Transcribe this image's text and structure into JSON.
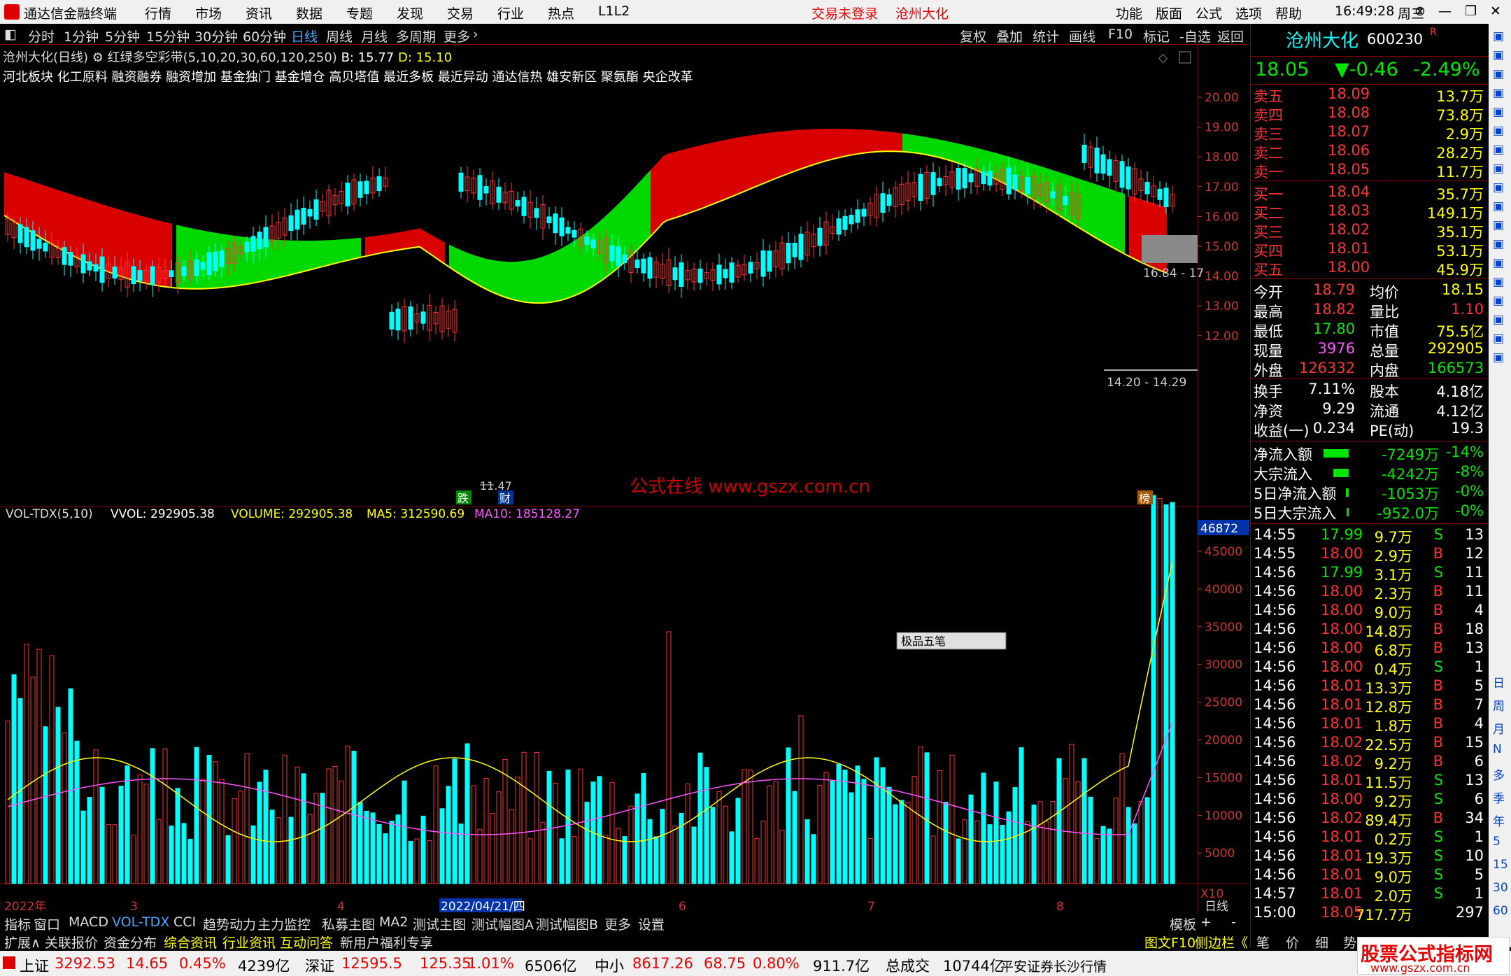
{
  "titlebar": {
    "app": "通达信金融终端",
    "menu": [
      "行情",
      "市场",
      "资讯",
      "数据",
      "专题",
      "发现",
      "交易",
      "行业",
      "热点",
      "L1L2"
    ],
    "login": "交易未登录",
    "stock": "沧州大化",
    "menu_right": [
      "功能",
      "版面",
      "公式",
      "选项",
      "帮助"
    ],
    "time": "16:49:28",
    "weekday": "周三"
  },
  "periodbar": {
    "items": [
      "分时",
      "1分钟",
      "5分钟",
      "15分钟",
      "30分钟",
      "60分钟",
      "日线",
      "周线",
      "月线",
      "多周期",
      "更多"
    ],
    "active": "日线",
    "right": [
      "复权",
      "叠加",
      "统计",
      "画线",
      "F10",
      "标记",
      "-自选",
      "返回"
    ]
  },
  "chart": {
    "name": "沧州大化(日线)",
    "indicator": "红绿多空彩带(5,10,20,30,60,120,250)",
    "b": "B: 15.77",
    "d": "D: 15.10",
    "concepts": "河北板块 化工原料 融资融券 融资增加 基金独门 基金增仓 高贝塔值 最近多板 最近异动 通达信热 雄安新区 聚氨酯 央企改革",
    "price_axis": [
      "20.00",
      "19.00",
      "18.00",
      "17.00",
      "16.00",
      "15.00",
      "14.00",
      "13.00",
      "12.00"
    ],
    "low_label": "11.47",
    "gap_label_1": "16.84 - 17",
    "gap_label_2": "14.20 - 14.29",
    "markers": [
      "跌",
      "财",
      "榜"
    ],
    "watermark": "公式在线  www.gszx.com.cn",
    "vol_info": {
      "name": "VOL-TDX(5,10)",
      "vvol": "VVOL: 292905.38",
      "volume": "VOLUME: 292905.38",
      "ma5": "MA5: 312590.69",
      "ma10": "MA10: 185128.27"
    },
    "vol_axis": [
      "45000",
      "40000",
      "35000",
      "30000",
      "25000",
      "20000",
      "15000",
      "10000",
      "5000"
    ],
    "vol_top": "46872",
    "vol_unit": "X10",
    "dates": [
      "2022年",
      "3",
      "4",
      "2022/04/21/四",
      "6",
      "7",
      "8"
    ],
    "period_label": "日线",
    "penbox": "极品五笔"
  },
  "quote": {
    "name": "沧州大化",
    "code": "600230",
    "price": "18.05",
    "change": "▼-0.46",
    "pct": "-2.49%",
    "sell": [
      [
        "卖五",
        "18.09",
        "13.7万"
      ],
      [
        "卖四",
        "18.08",
        "73.8万"
      ],
      [
        "卖三",
        "18.07",
        "2.9万"
      ],
      [
        "卖二",
        "18.06",
        "28.2万"
      ],
      [
        "卖一",
        "18.05",
        "11.7万"
      ]
    ],
    "buy": [
      [
        "买一",
        "18.04",
        "35.7万"
      ],
      [
        "买二",
        "18.03",
        "149.1万"
      ],
      [
        "买三",
        "18.02",
        "35.1万"
      ],
      [
        "买四",
        "18.01",
        "53.1万"
      ],
      [
        "买五",
        "18.00",
        "45.9万"
      ]
    ],
    "stats": [
      [
        "今开",
        "18.79",
        "均价",
        "18.15"
      ],
      [
        "最高",
        "18.82",
        "量比",
        "1.10"
      ],
      [
        "最低",
        "17.80",
        "市值",
        "75.5亿"
      ],
      [
        "现量",
        "3976",
        "总量",
        "292905"
      ],
      [
        "外盘",
        "126332",
        "内盘",
        "166573"
      ]
    ],
    "stats2": [
      [
        "换手",
        "7.11%",
        "股本",
        "4.18亿"
      ],
      [
        "净资",
        "9.29",
        "流通",
        "4.12亿"
      ],
      [
        "收益(一)",
        "0.234",
        "PE(动)",
        "19.3"
      ]
    ],
    "flows": [
      [
        "净流入额",
        "-7249万",
        "-14%"
      ],
      [
        "大宗流入",
        "-4242万",
        "-8%"
      ],
      [
        "5日净流入额",
        "-1053万",
        "-0%"
      ],
      [
        "5日大宗流入",
        "-952.0万",
        "-0%"
      ]
    ],
    "ticks": [
      [
        "14:55",
        "17.99",
        "9.7万",
        "S",
        "13"
      ],
      [
        "14:55",
        "18.00",
        "2.9万",
        "B",
        "12"
      ],
      [
        "14:56",
        "17.99",
        "3.1万",
        "S",
        "11"
      ],
      [
        "14:56",
        "18.00",
        "2.3万",
        "B",
        "11"
      ],
      [
        "14:56",
        "18.00",
        "9.0万",
        "B",
        "4"
      ],
      [
        "14:56",
        "18.00",
        "14.8万",
        "B",
        "18"
      ],
      [
        "14:56",
        "18.00",
        "6.8万",
        "B",
        "13"
      ],
      [
        "14:56",
        "18.00",
        "0.4万",
        "S",
        "1"
      ],
      [
        "14:56",
        "18.01",
        "13.3万",
        "B",
        "5"
      ],
      [
        "14:56",
        "18.01",
        "12.8万",
        "B",
        "7"
      ],
      [
        "14:56",
        "18.01",
        "1.8万",
        "B",
        "4"
      ],
      [
        "14:56",
        "18.02",
        "22.5万",
        "B",
        "15"
      ],
      [
        "14:56",
        "18.02",
        "9.2万",
        "B",
        "6"
      ],
      [
        "14:56",
        "18.01",
        "11.5万",
        "S",
        "13"
      ],
      [
        "14:56",
        "18.00",
        "9.2万",
        "S",
        "6"
      ],
      [
        "14:56",
        "18.02",
        "89.4万",
        "B",
        "34"
      ],
      [
        "14:56",
        "18.01",
        "0.2万",
        "S",
        "1"
      ],
      [
        "14:56",
        "18.01",
        "19.3万",
        "S",
        "10"
      ],
      [
        "14:56",
        "18.01",
        "9.0万",
        "S",
        "5"
      ],
      [
        "14:57",
        "18.01",
        "2.0万",
        "S",
        "1"
      ],
      [
        "15:00",
        "18.05",
        "717.7万",
        "",
        "297"
      ]
    ]
  },
  "tabs": [
    "指标",
    "窗口",
    "MACD",
    "VOL-TDX",
    "CCI",
    "趋势动力",
    "主力监控",
    "私募主图",
    "MA2",
    "测试主图",
    "测试幅图A",
    "测试幅图B",
    "更多",
    "设置"
  ],
  "tabs_right": [
    "模板",
    "+",
    "-"
  ],
  "tabs2": [
    "扩展∧",
    "关联报价",
    "资金分布",
    "综合资讯",
    "行业资讯",
    "互动问答",
    "新用户福利专享"
  ],
  "tabs2_right": [
    "图文F10",
    "侧边栏《",
    "笔",
    "价",
    "细",
    "势"
  ],
  "side": [
    "日",
    "周",
    "月",
    "N",
    "多",
    "季",
    "年",
    "5",
    "15",
    "30",
    "60"
  ],
  "status": {
    "sh_name": "上证",
    "sh": "3292.53",
    "sh_chg": "14.65",
    "sh_pct": "0.45%",
    "sh_amt": "4239亿",
    "sz_name": "深证",
    "sz": "12595.5",
    "sz_chg": "125.35",
    "sz_pct": "1.01%",
    "sz_amt": "6506亿",
    "zx_name": "中小",
    "zx": "8617.26",
    "zx_chg": "68.75",
    "zx_pct": "0.80%",
    "zx_amt": "911.7亿",
    "total_name": "总成交",
    "total": "10744亿",
    "broker": "平安证券长沙行情",
    "logo_line1": "股票公式指标网",
    "logo_line2": "www.gszx.com.cn"
  }
}
